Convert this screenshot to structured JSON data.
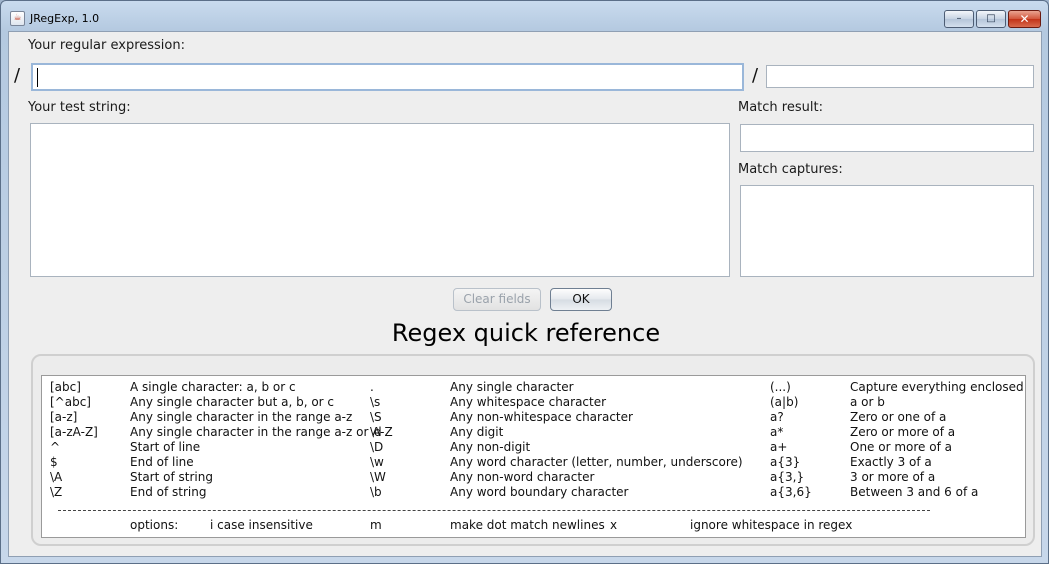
{
  "window": {
    "title": "JRegExp, 1.0",
    "controls": {
      "minimize": "–",
      "maximize": "□",
      "close": "✕"
    }
  },
  "regex": {
    "label": "Your regular expression:",
    "slash_open": "/",
    "slash_close": "/",
    "value": "",
    "flags_value": ""
  },
  "test": {
    "label": "Your test string:",
    "value": ""
  },
  "match_result": {
    "label": "Match result:",
    "value": ""
  },
  "match_captures": {
    "label": "Match captures:",
    "value": ""
  },
  "buttons": {
    "clear": "Clear fields",
    "ok": "OK"
  },
  "quick_ref": {
    "title": "Regex quick reference",
    "rows": [
      [
        "[abc]",
        "A single character: a, b or c",
        ".",
        "Any single character",
        "(...)",
        "Capture everything enclosed"
      ],
      [
        "[^abc]",
        "Any single character but a, b, or c",
        "\\s",
        "Any whitespace character",
        "(a|b)",
        "a or b"
      ],
      [
        "[a-z]",
        "Any single character in the range a-z",
        "\\S",
        "Any non-whitespace character",
        "a?",
        "Zero or one of a"
      ],
      [
        "[a-zA-Z]",
        "Any single character in the range a-z or A-Z",
        "\\d",
        "Any digit",
        "a*",
        "Zero or more of a"
      ],
      [
        "^",
        "Start of line",
        "\\D",
        "Any non-digit",
        "a+",
        "One or more of a"
      ],
      [
        "$",
        "End of line",
        "\\w",
        "Any word character (letter, number, underscore)",
        "a{3}",
        "Exactly 3 of a"
      ],
      [
        "\\A",
        "Start of string",
        "\\W",
        "Any non-word character",
        "a{3,}",
        "3 or more of a"
      ],
      [
        "\\Z",
        "End of string",
        "\\b",
        "Any word boundary character",
        "a{3,6}",
        "Between 3 and 6 of a"
      ]
    ],
    "options": {
      "label": "options:",
      "i": "i case insensitive",
      "m_key": "m",
      "m_desc": "make dot match newlines",
      "x_key": "x",
      "x_desc": "ignore whitespace in regex"
    }
  }
}
